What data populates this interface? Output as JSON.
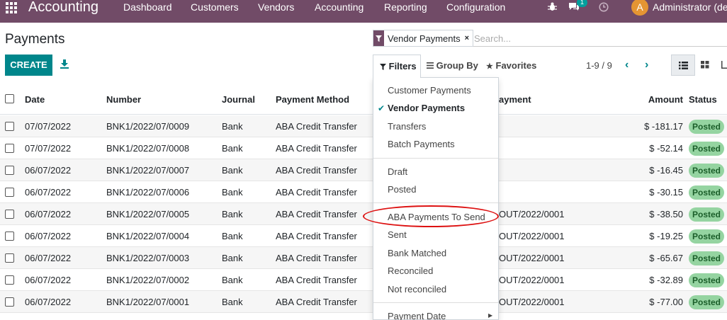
{
  "nav": {
    "app_title": "Accounting",
    "menu": [
      "Dashboard",
      "Customers",
      "Vendors",
      "Accounting",
      "Reporting",
      "Configuration"
    ],
    "chat_count": "1",
    "avatar_letter": "A",
    "user_name": "Administrator (den"
  },
  "page": {
    "title": "Payments",
    "create_label": "CREATE"
  },
  "search": {
    "facet_value": "Vendor Payments",
    "remove_glyph": "×",
    "placeholder": "Search..."
  },
  "toolbar": {
    "filters_label": "Filters",
    "groupby_label": "Group By",
    "favorites_label": "Favorites",
    "pager": "1-9 / 9",
    "prev_glyph": "‹",
    "next_glyph": "›"
  },
  "table": {
    "headers": {
      "date": "Date",
      "number": "Number",
      "journal": "Journal",
      "payment_method": "Payment Method",
      "batch_payment": "ayment",
      "amount": "Amount",
      "status": "Status"
    },
    "rows": [
      {
        "date": "07/07/2022",
        "number": "BNK1/2022/07/0009",
        "journal": "Bank",
        "method": "ABA Credit Transfer",
        "batch": "",
        "amount": "$ -181.17",
        "status": "Posted"
      },
      {
        "date": "07/07/2022",
        "number": "BNK1/2022/07/0008",
        "journal": "Bank",
        "method": "ABA Credit Transfer",
        "batch": "",
        "amount": "$ -52.14",
        "status": "Posted"
      },
      {
        "date": "06/07/2022",
        "number": "BNK1/2022/07/0007",
        "journal": "Bank",
        "method": "ABA Credit Transfer",
        "batch": "",
        "amount": "$ -16.45",
        "status": "Posted"
      },
      {
        "date": "06/07/2022",
        "number": "BNK1/2022/07/0006",
        "journal": "Bank",
        "method": "ABA Credit Transfer",
        "batch": "",
        "amount": "$ -30.15",
        "status": "Posted"
      },
      {
        "date": "06/07/2022",
        "number": "BNK1/2022/07/0005",
        "journal": "Bank",
        "method": "ABA Credit Transfer",
        "batch": "OUT/2022/0001",
        "amount": "$ -38.50",
        "status": "Posted"
      },
      {
        "date": "06/07/2022",
        "number": "BNK1/2022/07/0004",
        "journal": "Bank",
        "method": "ABA Credit Transfer",
        "batch": "OUT/2022/0001",
        "amount": "$ -19.25",
        "status": "Posted"
      },
      {
        "date": "06/07/2022",
        "number": "BNK1/2022/07/0003",
        "journal": "Bank",
        "method": "ABA Credit Transfer",
        "batch": "OUT/2022/0001",
        "amount": "$ -65.67",
        "status": "Posted"
      },
      {
        "date": "06/07/2022",
        "number": "BNK1/2022/07/0002",
        "journal": "Bank",
        "method": "ABA Credit Transfer",
        "batch": "OUT/2022/0001",
        "amount": "$ -32.89",
        "status": "Posted"
      },
      {
        "date": "06/07/2022",
        "number": "BNK1/2022/07/0001",
        "journal": "Bank",
        "method": "ABA Credit Transfer",
        "batch": "OUT/2022/0001",
        "amount": "$ -77.00",
        "status": "Posted"
      }
    ]
  },
  "filters_menu": {
    "group1": [
      "Customer Payments",
      "Vendor Payments",
      "Transfers",
      "Batch Payments"
    ],
    "selected": "Vendor Payments",
    "group2": [
      "Draft",
      "Posted"
    ],
    "group3": [
      "ABA Payments To Send",
      "Sent",
      "Bank Matched",
      "Reconciled",
      "Not reconciled"
    ],
    "group4": [
      "Payment Date"
    ],
    "highlighted": "ABA Payments To Send"
  },
  "colors": {
    "nav_bg": "#714b67",
    "primary": "#00868b",
    "posted_badge": "#95d4a1",
    "highlight_ring": "#d11111"
  },
  "icons": [
    "apps-grid-icon",
    "download-icon",
    "filter-funnel-icon",
    "group-by-lines-icon",
    "star-icon",
    "bug-icon",
    "chat-icon",
    "clock-icon",
    "list-view-icon",
    "kanban-view-icon",
    "graph-view-icon",
    "checkmark-icon",
    "caret-right-icon"
  ]
}
